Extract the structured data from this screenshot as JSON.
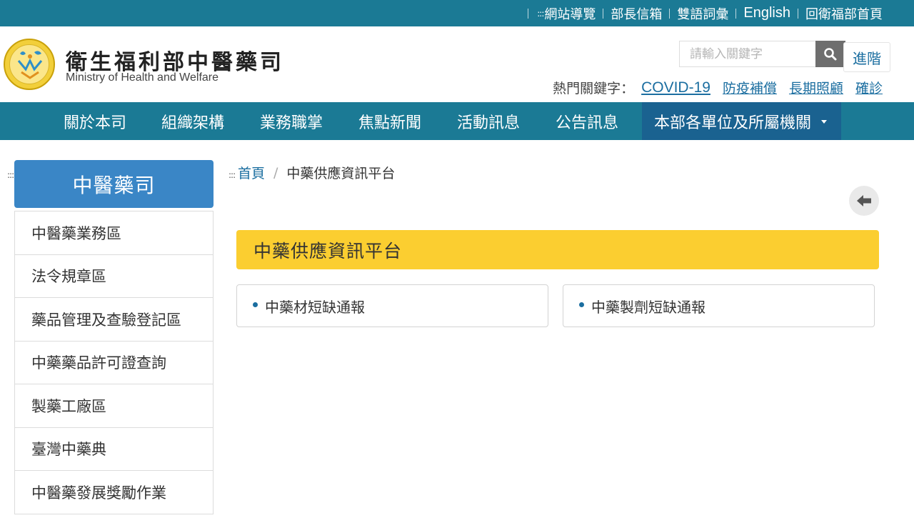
{
  "accesskey_mark": ":::",
  "topbar": {
    "links": [
      {
        "label": "網站導覽"
      },
      {
        "label": "部長信箱"
      },
      {
        "label": "雙語詞彙"
      },
      {
        "label": "English"
      },
      {
        "label": "回衛福部首頁"
      }
    ]
  },
  "header": {
    "title": "衛生福利部中醫藥司",
    "subtitle": "Ministry of Health and Welfare"
  },
  "search": {
    "placeholder": "請輸入關鍵字",
    "value": "",
    "advanced_label": "進階"
  },
  "hot_keywords": {
    "label": "熱門關鍵字：",
    "items": [
      "COVID-19",
      "防疫補償",
      "長期照顧",
      "確診"
    ]
  },
  "nav": {
    "items": [
      {
        "label": "關於本司"
      },
      {
        "label": "組織架構"
      },
      {
        "label": "業務職掌"
      },
      {
        "label": "焦點新聞"
      },
      {
        "label": "活動訊息"
      },
      {
        "label": "公告訊息"
      },
      {
        "label": "本部各單位及所屬機關"
      }
    ]
  },
  "sidebar": {
    "title": "中醫藥司",
    "items": [
      {
        "label": "中醫藥業務區"
      },
      {
        "label": "法令規章區"
      },
      {
        "label": "藥品管理及查驗登記區"
      },
      {
        "label": "中藥藥品許可證查詢"
      },
      {
        "label": "製藥工廠區"
      },
      {
        "label": "臺灣中藥典"
      },
      {
        "label": "中醫藥發展獎勵作業"
      }
    ]
  },
  "breadcrumb": {
    "home": "首頁",
    "separator": "/",
    "current": "中藥供應資訊平台"
  },
  "main": {
    "section_title": "中藥供應資訊平台",
    "cards": [
      {
        "label": "中藥材短缺通報"
      },
      {
        "label": "中藥製劑短缺通報"
      }
    ]
  },
  "icons": {
    "search": "search-icon",
    "back": "arrow-left-icon",
    "dropdown": "caret-down-icon",
    "logo": "ministry-emblem-icon"
  },
  "colors": {
    "brand_teal": "#1b7a95",
    "dropdown_blue": "#1a6290",
    "sidebar_head": "#3a86c6",
    "section_yellow": "#fbce30",
    "link_blue": "#1b6ea0"
  }
}
